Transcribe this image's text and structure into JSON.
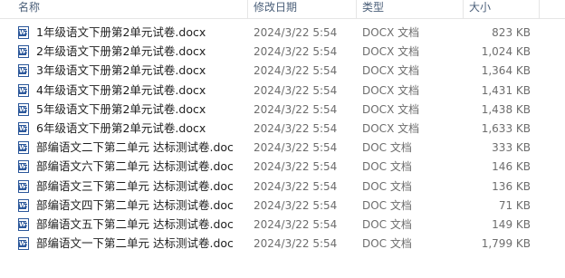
{
  "columns": {
    "name": "名称",
    "date": "修改日期",
    "type": "类型",
    "size": "大小"
  },
  "files": [
    {
      "name": "1年级语文下册第2单元试卷.docx",
      "date": "2024/3/22 5:54",
      "type": "DOCX 文档",
      "size": "823 KB",
      "icon": "word-document-icon"
    },
    {
      "name": "2年级语文下册第2单元试卷.docx",
      "date": "2024/3/22 5:54",
      "type": "DOCX 文档",
      "size": "1,024 KB",
      "icon": "word-document-icon"
    },
    {
      "name": "3年级语文下册第2单元试卷.docx",
      "date": "2024/3/22 5:54",
      "type": "DOCX 文档",
      "size": "1,364 KB",
      "icon": "word-document-icon"
    },
    {
      "name": "4年级语文下册第2单元试卷.docx",
      "date": "2024/3/22 5:54",
      "type": "DOCX 文档",
      "size": "1,431 KB",
      "icon": "word-document-icon"
    },
    {
      "name": "5年级语文下册第2单元试卷.docx",
      "date": "2024/3/22 5:54",
      "type": "DOCX 文档",
      "size": "1,438 KB",
      "icon": "word-document-icon"
    },
    {
      "name": "6年级语文下册第2单元试卷.docx",
      "date": "2024/3/22 5:54",
      "type": "DOCX 文档",
      "size": "1,633 KB",
      "icon": "word-document-icon"
    },
    {
      "name": "部编语文二下第二单元 达标测试卷.doc",
      "date": "2024/3/22 5:54",
      "type": "DOC 文档",
      "size": "333 KB",
      "icon": "word-document-icon"
    },
    {
      "name": "部编语文六下第二单元 达标测试卷.doc",
      "date": "2024/3/22 5:54",
      "type": "DOC 文档",
      "size": "146 KB",
      "icon": "word-document-icon"
    },
    {
      "name": "部编语文三下第二单元 达标测试卷.doc",
      "date": "2024/3/22 5:54",
      "type": "DOC 文档",
      "size": "136 KB",
      "icon": "word-document-icon"
    },
    {
      "name": "部编语文四下第二单元 达标测试卷.doc",
      "date": "2024/3/22 5:54",
      "type": "DOC 文档",
      "size": "71 KB",
      "icon": "word-document-icon"
    },
    {
      "name": "部编语文五下第二单元 达标测试卷.doc",
      "date": "2024/3/22 5:54",
      "type": "DOC 文档",
      "size": "149 KB",
      "icon": "word-document-icon"
    },
    {
      "name": "部编语文一下第二单元 达标测试卷.doc",
      "date": "2024/3/22 5:54",
      "type": "DOC 文档",
      "size": "1,799 KB",
      "icon": "word-document-icon"
    }
  ],
  "colors": {
    "header_text": "#4c607a",
    "word_blue": "#2b579a",
    "meta_text": "#6d6d6d"
  }
}
